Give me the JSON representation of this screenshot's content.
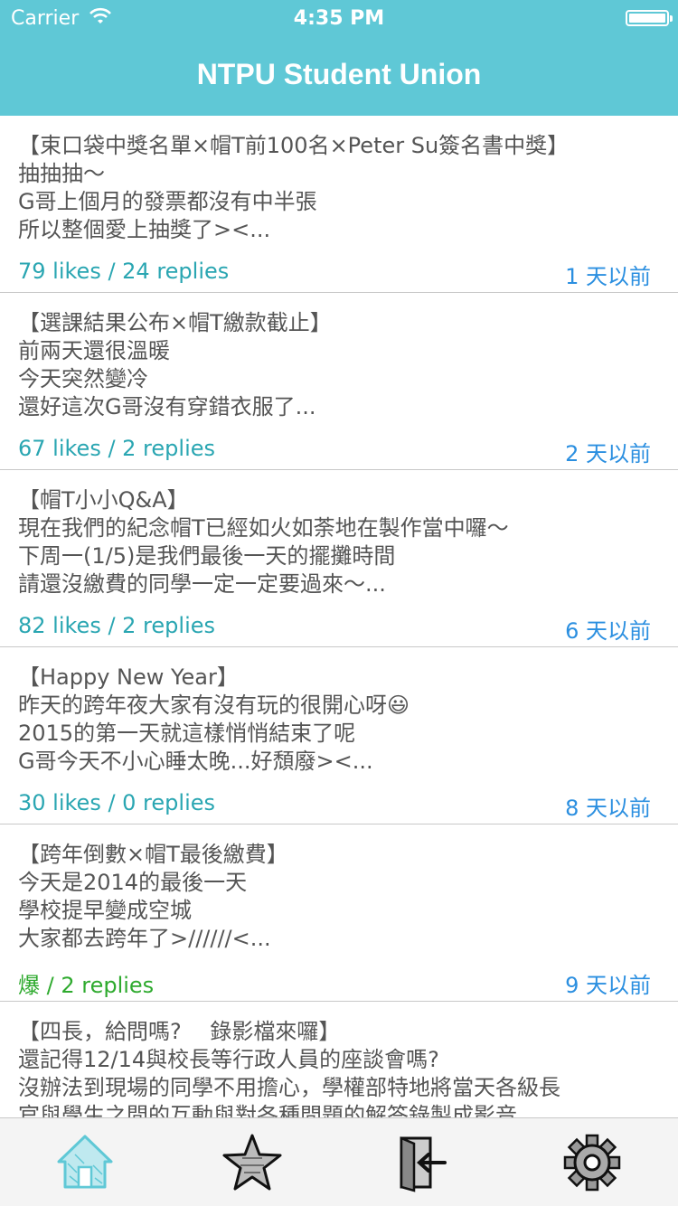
{
  "status": {
    "carrier": "Carrier",
    "time": "4:35 PM"
  },
  "nav": {
    "title": "NTPU Student Union"
  },
  "posts": [
    {
      "lines": [
        "【束口袋中獎名單×帽T前100名×Peter Su簽名書中獎】",
        "抽抽抽～",
        "G哥上個月的發票都沒有中半張",
        "所以整個愛上抽獎了><..."
      ],
      "stats": "79 likes / 24 replies",
      "when": "1 天以前"
    },
    {
      "lines": [
        "【選課結果公布×帽T繳款截止】",
        "前兩天還很溫暖",
        "今天突然變冷",
        "還好這次G哥沒有穿錯衣服了..."
      ],
      "stats": "67 likes / 2 replies",
      "when": "2 天以前"
    },
    {
      "lines": [
        "【帽T小小Q&A】",
        "現在我們的紀念帽T已經如火如荼地在製作當中囉～",
        "下周一(1/5)是我們最後一天的擺攤時間",
        "請還沒繳費的同學一定一定要過來～..."
      ],
      "stats": "82 likes / 2 replies",
      "when": "6 天以前"
    },
    {
      "lines": [
        "【Happy New Year】",
        "昨天的跨年夜大家有沒有玩的很開心呀😃",
        "2015的第一天就這樣悄悄結束了呢",
        "G哥今天不小心睡太晚...好頹廢><..."
      ],
      "stats": "30 likes / 0 replies",
      "when": "8 天以前"
    },
    {
      "lines": [
        "【跨年倒數×帽T最後繳費】",
        "今天是2014的最後一天",
        "學校提早變成空城",
        "大家都去跨年了>//////<..."
      ],
      "stats": "爆 / 2 replies",
      "when": "9 天以前"
    },
    {
      "lines": [
        "【四長，給問嗎?　 錄影檔來囉】",
        "還記得12/14與校長等行政人員的座談會嗎?",
        "沒辦法到現場的同學不用擔心，學權部特地將當天各級長",
        "官與學生之間的互動與對各種問題的解答錄製成影音..."
      ],
      "stats": "",
      "when": ""
    }
  ],
  "tabs": [
    {
      "icon": "home-icon"
    },
    {
      "icon": "star-icon"
    },
    {
      "icon": "logout-icon"
    },
    {
      "icon": "gear-icon"
    }
  ],
  "colors": {
    "nav_bg": "#5fc8d6",
    "stats": "#2aa6b2",
    "hot": "#2eaa2e",
    "when": "#2b8fe0"
  }
}
